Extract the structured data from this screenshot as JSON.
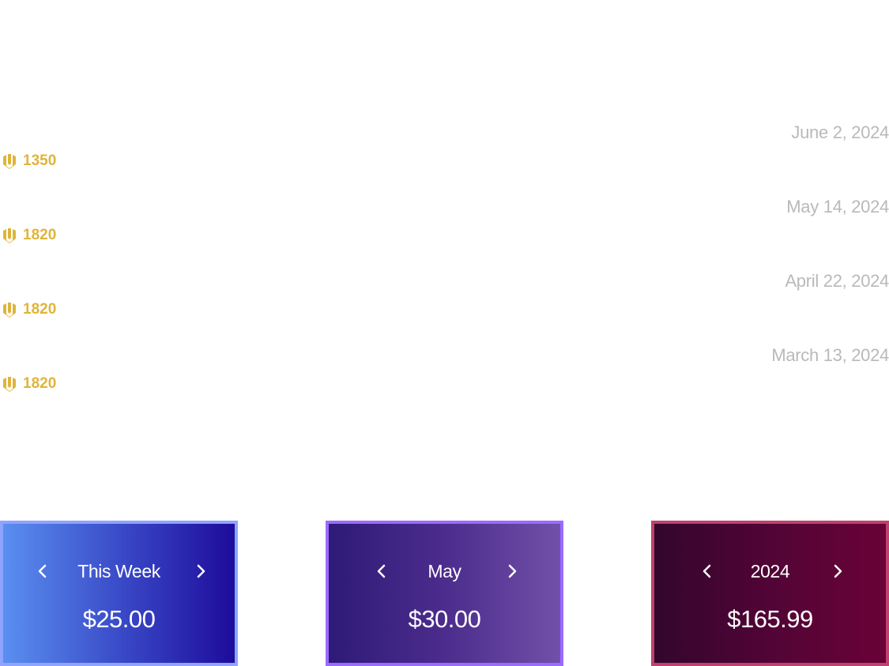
{
  "entries": [
    {
      "date": "June 2, 2024",
      "points": "1350"
    },
    {
      "date": "May 14, 2024",
      "points": "1820"
    },
    {
      "date": "April 22, 2024",
      "points": "1820"
    },
    {
      "date": "March 13, 2024",
      "points": "1820"
    }
  ],
  "summary_cards": {
    "week": {
      "period": "This Week",
      "amount": "$25.00"
    },
    "month": {
      "period": "May",
      "amount": "$30.00"
    },
    "year": {
      "period": "2024",
      "amount": "$165.99"
    }
  },
  "icons": {
    "points": "coin-badge-icon",
    "prev": "chevron-left-icon",
    "next": "chevron-right-icon"
  },
  "colors": {
    "date_text": "#b9b9b9",
    "points_gold": "#e0b43a",
    "card_text": "#ffffff"
  }
}
